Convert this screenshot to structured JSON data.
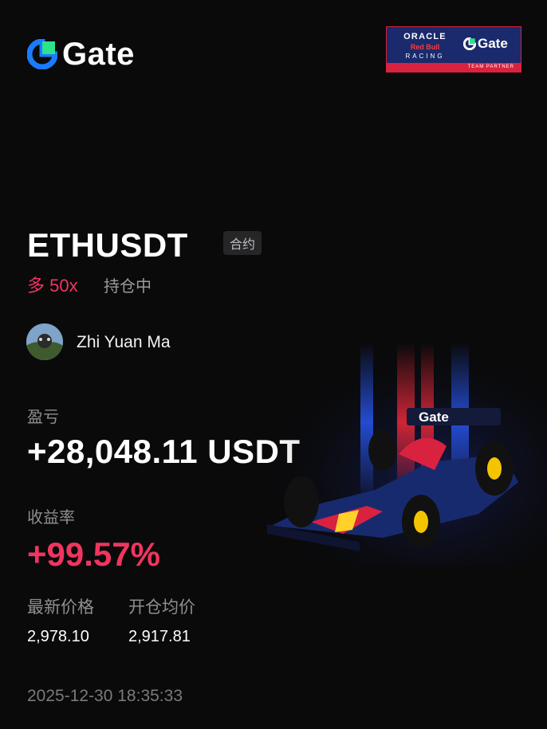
{
  "brand": {
    "logo_text": "Gate",
    "accent": "#1A7BFF",
    "accent_green": "#2DE28A"
  },
  "partner_badge": {
    "oracle": "ORACLE",
    "redbull": "Red Bull",
    "racing": "RACING",
    "gate": "Gate",
    "strip": "TEAM PARTNER"
  },
  "position": {
    "symbol": "ETHUSDT",
    "type_tag": "合约",
    "side_leverage": "多 50x",
    "status": "持仓中"
  },
  "user": {
    "name": "Zhi Yuan Ma"
  },
  "pnl": {
    "label": "盈亏",
    "value": "+28,048.11 USDT"
  },
  "return_rate": {
    "label": "收益率",
    "value": "+99.57%"
  },
  "prices": {
    "last_label": "最新价格",
    "last_value": "2,978.10",
    "entry_label": "开仓均价",
    "entry_value": "2,917.81"
  },
  "timestamp": "2025-12-30 18:35:33",
  "colors": {
    "bg": "#0A0A0B",
    "profit": "#F0355E",
    "muted": "#8F8F8F"
  },
  "car_livery_text": "Gate"
}
